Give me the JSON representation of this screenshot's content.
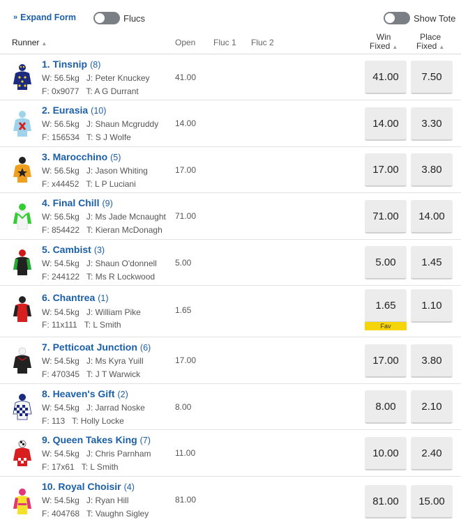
{
  "controls": {
    "expand_label": "Expand Form",
    "flucs_label": "Flucs",
    "show_tote_label": "Show Tote"
  },
  "columns": {
    "runner": "Runner",
    "open": "Open",
    "fluc1": "Fluc 1",
    "fluc2": "Fluc 2",
    "win_line1": "Win",
    "win_line2": "Fixed",
    "place_line1": "Place",
    "place_line2": "Fixed"
  },
  "runners": [
    {
      "name": "1. Tinsnip",
      "barrier": "(8)",
      "weight": "W: 56.5kg",
      "jockey": "J: Peter Knuckey",
      "form": "F: 0x9077",
      "trainer": "T: A G Durrant",
      "open": "41.00",
      "win": "41.00",
      "place": "7.50",
      "silk": "navy-stars"
    },
    {
      "name": "2. Eurasia",
      "barrier": "(10)",
      "weight": "W: 56.5kg",
      "jockey": "J: Shaun Mcgruddy",
      "form": "F: 156534",
      "trainer": "T: S J Wolfe",
      "open": "14.00",
      "win": "14.00",
      "place": "3.30",
      "silk": "lightblue-redcross"
    },
    {
      "name": "3. Marocchino",
      "barrier": "(5)",
      "weight": "W: 56.5kg",
      "jockey": "J: Jason Whiting",
      "form": "F: x44452",
      "trainer": "T: L P Luciani",
      "open": "17.00",
      "win": "17.00",
      "place": "3.80",
      "silk": "orange-blackstar"
    },
    {
      "name": "4. Final Chill",
      "barrier": "(9)",
      "weight": "W: 56.5kg",
      "jockey": "J: Ms Jade Mcnaught",
      "form": "F: 854422",
      "trainer": "T: Kieran McDonagh",
      "open": "71.00",
      "win": "71.00",
      "place": "14.00",
      "silk": "white-green"
    },
    {
      "name": "5. Cambist",
      "barrier": "(3)",
      "weight": "W: 54.5kg",
      "jockey": "J: Shaun O'donnell",
      "form": "F: 244122",
      "trainer": "T: Ms R Lockwood",
      "open": "5.00",
      "win": "5.00",
      "place": "1.45",
      "silk": "black-green"
    },
    {
      "name": "6. Chantrea",
      "barrier": "(1)",
      "weight": "W: 54.5kg",
      "jockey": "J: William Pike",
      "form": "F: 11x111",
      "trainer": "T: L Smith",
      "open": "1.65",
      "win": "1.65",
      "place": "1.10",
      "silk": "red-black",
      "fav": "Fav"
    },
    {
      "name": "7. Petticoat Junction",
      "barrier": "(6)",
      "weight": "W: 54.5kg",
      "jockey": "J: Ms Kyra Yuill",
      "form": "F: 470345",
      "trainer": "T: J T Warwick",
      "open": "17.00",
      "win": "17.00",
      "place": "3.80",
      "silk": "black-white"
    },
    {
      "name": "8. Heaven's Gift",
      "barrier": "(2)",
      "weight": "W: 54.5kg",
      "jockey": "J: Jarrad Noske",
      "form": "F: 113",
      "trainer": "T: Holly Locke",
      "open": "8.00",
      "win": "8.00",
      "place": "2.10",
      "silk": "navy-checks"
    },
    {
      "name": "9. Queen Takes King",
      "barrier": "(7)",
      "weight": "W: 54.5kg",
      "jockey": "J: Chris Parnham",
      "form": "F: 17x61",
      "trainer": "T: L Smith",
      "open": "11.00",
      "win": "10.00",
      "place": "2.40",
      "silk": "red-checkcap"
    },
    {
      "name": "10. Royal Choisir",
      "barrier": "(4)",
      "weight": "W: 54.5kg",
      "jockey": "J: Ryan Hill",
      "form": "F: 404768",
      "trainer": "T: Vaughn Sigley",
      "open": "81.00",
      "win": "81.00",
      "place": "15.00",
      "silk": "yellow-pink"
    }
  ]
}
